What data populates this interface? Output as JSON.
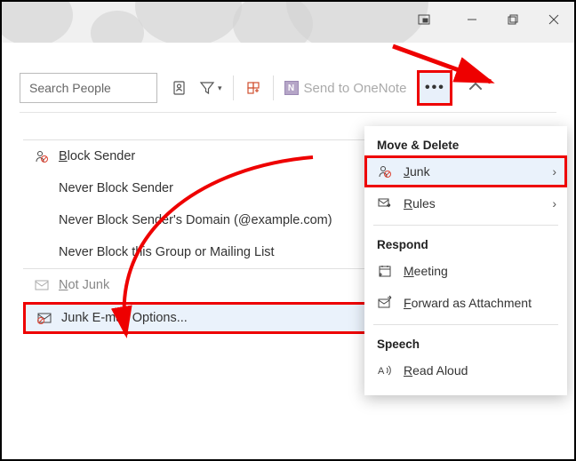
{
  "search": {
    "placeholder": "Search People"
  },
  "ribbon": {
    "onenote_label": "Send to OneNote"
  },
  "submenu": {
    "block_sender": "lock Sender",
    "never_block_sender": "Never Block Sender",
    "never_block_domain": "Never Block Sender's Domain (@example.com)",
    "never_block_group": "Never Block this Group or Mailing List",
    "not_junk": "ot Junk",
    "junk_options": "Junk E-mail Options..."
  },
  "overflow": {
    "section_move_delete": "Move & Delete",
    "junk": "unk",
    "rules": "ules",
    "section_respond": "Respond",
    "meeting": "eeting",
    "forward": "orward as Attachment",
    "section_speech": "Speech",
    "read_aloud": "ead Aloud"
  }
}
